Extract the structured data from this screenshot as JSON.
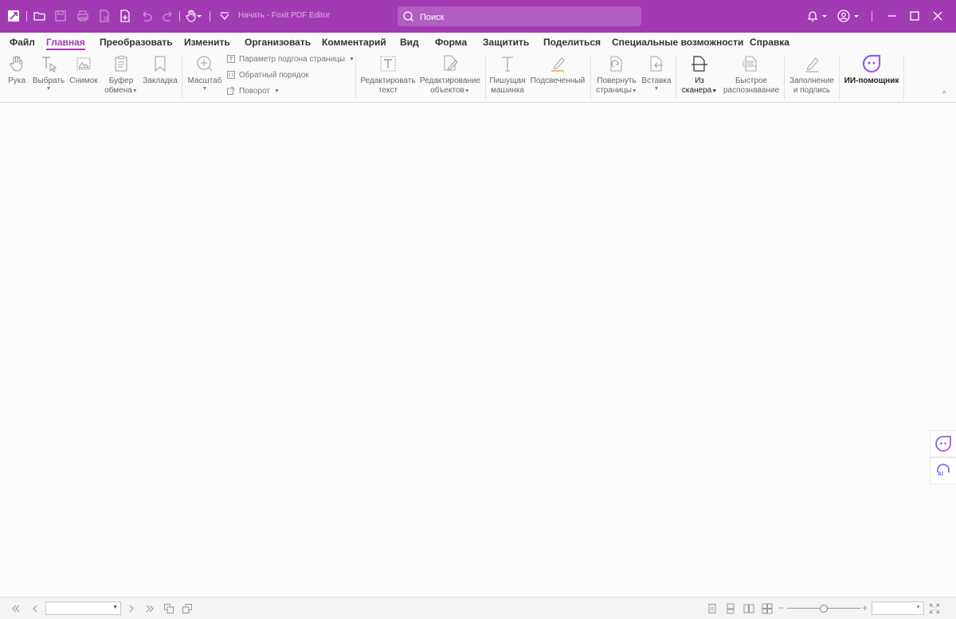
{
  "titlebar": {
    "app_title": "Начать - Foxit PDF Editor",
    "search_placeholder": "Поиск",
    "brand_color": "#a23ab4"
  },
  "menu": {
    "items": [
      "Файл",
      "Главная",
      "Преобразовать",
      "Изменить",
      "Организовать",
      "Комментарий",
      "Вид",
      "Форма",
      "Защитить",
      "Поделиться",
      "Специальные возможности",
      "Справка"
    ],
    "active": "Главная"
  },
  "ribbon": {
    "hand": "Рука",
    "select": "Выбрать",
    "snapshot": "Снимок",
    "clipboard_1": "Буфер",
    "clipboard_2": "обмена",
    "bookmark": "Закладка",
    "zoom": "Масштаб",
    "fit_page": "Параметр подгона страницы",
    "reverse_order": "Обратный порядок",
    "rotate": "Поворот",
    "edit_text_1": "Редактировать",
    "edit_text_2": "текст",
    "edit_objects_1": "Редактирование",
    "edit_objects_2": "объектов",
    "typewriter_1": "Пишущая",
    "typewriter_2": "машинка",
    "highlight": "Подсвеченный",
    "rotate_pages_1": "Повернуть",
    "rotate_pages_2": "страницы",
    "insert": "Вставка",
    "from_scanner_1": "Из",
    "from_scanner_2": "сканера",
    "quick_ocr_1": "Быстрое",
    "quick_ocr_2": "распознавание",
    "fill_sign_1": "Заполнение",
    "fill_sign_2": "и подпись",
    "ai_assistant": "ИИ-помощник"
  },
  "sidebar": {
    "ai_label": "AI"
  },
  "statusbar": {
    "page_value": "",
    "zoom_value": "",
    "zoom_minus": "−",
    "zoom_plus": "+"
  }
}
